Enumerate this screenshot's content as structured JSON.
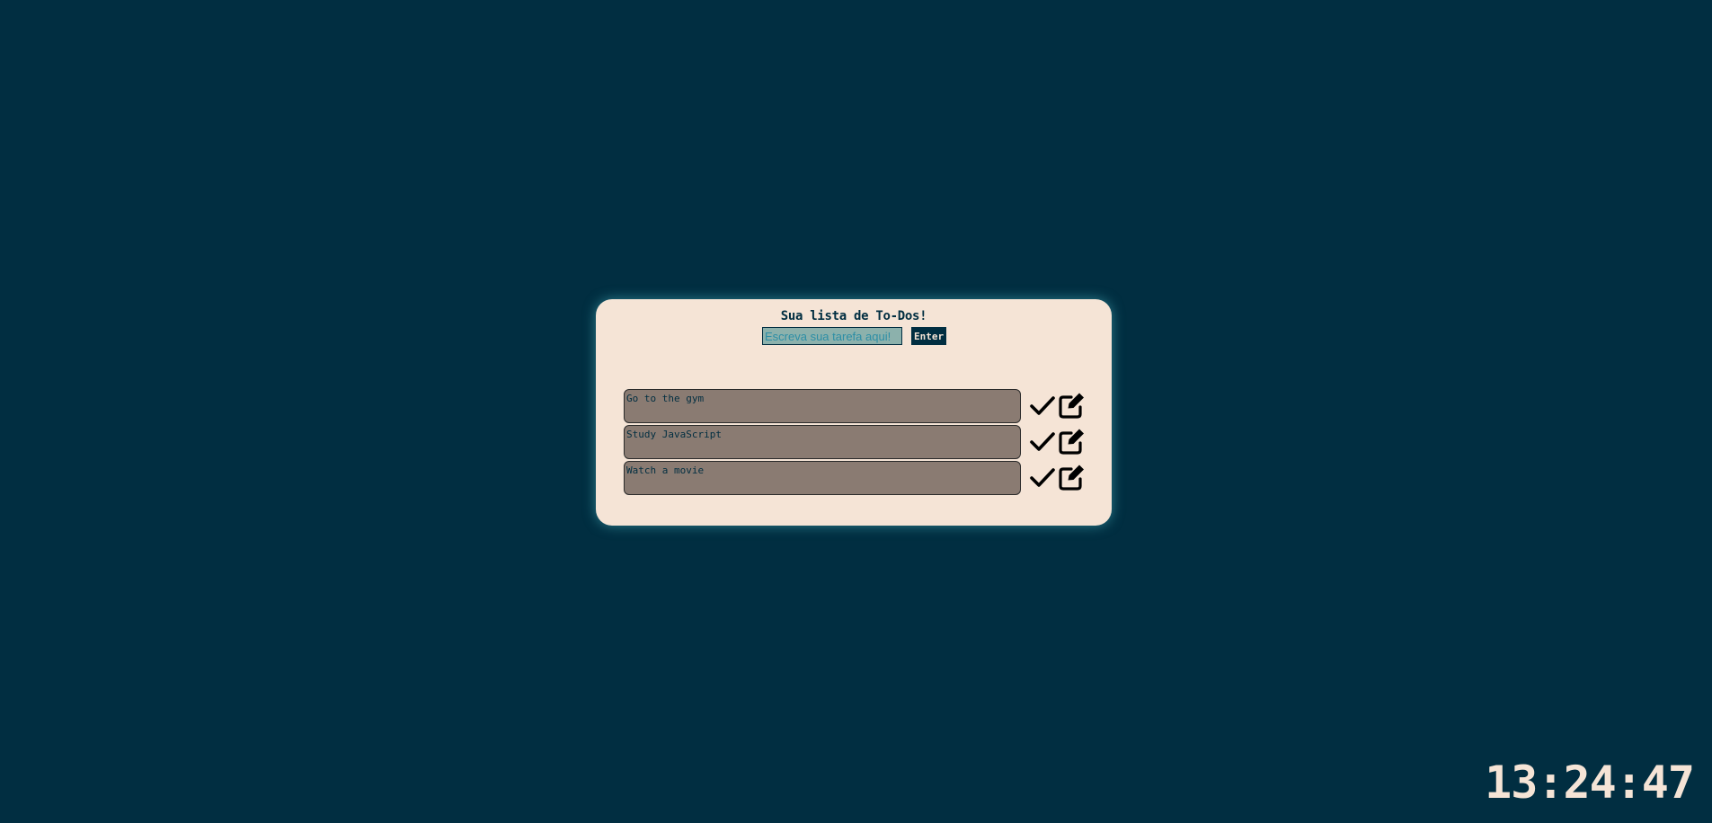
{
  "todo_app": {
    "title": "Sua lista de To-Dos!",
    "input_placeholder": "Escreva sua tarefa aqui!",
    "input_value": "",
    "enter_label": "Enter",
    "items": [
      {
        "text": "Go to the gym",
        "complete_icon": "check-icon",
        "edit_icon": "edit-icon"
      },
      {
        "text": "Study JavaScript",
        "complete_icon": "check-icon",
        "edit_icon": "edit-icon"
      },
      {
        "text": "Watch a movie",
        "complete_icon": "check-icon",
        "edit_icon": "edit-icon"
      }
    ]
  },
  "clock": {
    "time": "13:24:47"
  },
  "colors": {
    "background": "#012e41",
    "card": "#f5e4d6",
    "task_box": "#8a7b72",
    "input": "#8cb1ac",
    "glow": "#50bec8"
  }
}
